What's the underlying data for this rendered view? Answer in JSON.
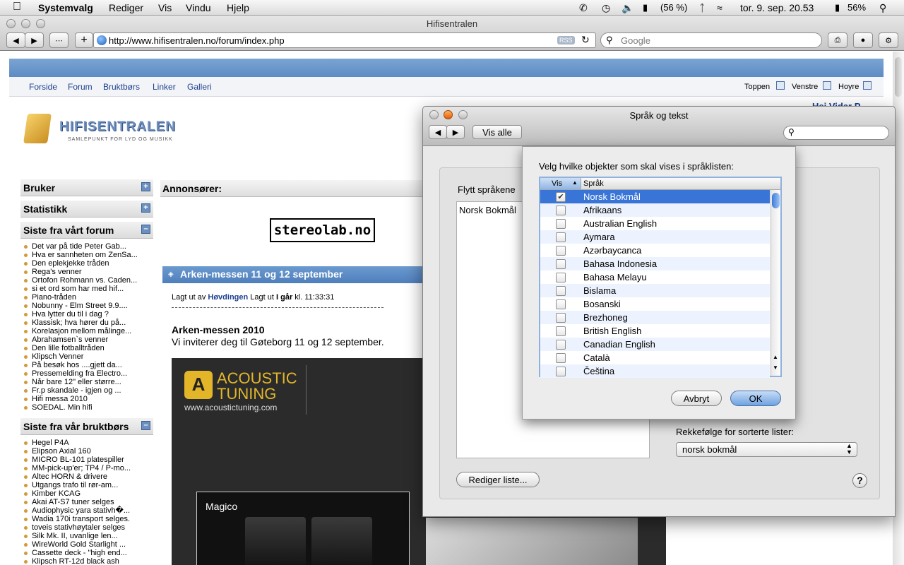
{
  "menubar": {
    "app": "Systemvalg",
    "items": [
      "Rediger",
      "Vis",
      "Vindu",
      "Hjelp"
    ],
    "battery_pct": "(56 %)",
    "clock": "tor. 9. sep. 20.53",
    "battery2": "56%"
  },
  "browser": {
    "title": "Hifisentralen",
    "url": "http://www.hifisentralen.no/forum/index.php",
    "rss": "RSS",
    "search_placeholder": "Google"
  },
  "site": {
    "nav": [
      "Forside",
      "Forum",
      "Bruktbørs",
      "Linker",
      "Galleri"
    ],
    "right_nav": [
      "Toppen",
      "Venstre",
      "Hoyre"
    ],
    "user_greeting": "Hei Vidar P",
    "logo_title": "HIFISENTRALEN",
    "logo_sub": "SAMLEPUNKT FOR LYD OG MUSIKK",
    "side_heads": [
      "Bruker",
      "Statistikk",
      "Siste fra vårt forum",
      "Siste fra vår bruktbørs"
    ],
    "forum_items": [
      "Det var på tide Peter Gab...",
      "Hva er sannheten om ZenSa...",
      "Den eplekjekke tråden",
      "Rega's venner",
      "Ortofon Rohmann vs. Caden...",
      "si et ord som har med hif...",
      "Piano-tråden",
      "Nobunny - Elm Street 9.9....",
      "Hva lytter du til i dag ?",
      "Klassisk; hva hører du på...",
      "Korelasjon mellom målinge...",
      "Abrahamsen`s venner",
      "Den lille fotballtråden",
      "Klipsch Venner",
      "På besøk hos ....gjett da...",
      "Pressemelding fra Electro...",
      "Når bare 12\" eller større...",
      "Fr.p skandale - igjen og ...",
      "Hifi messa 2010",
      "SOEDAL. Min hifi"
    ],
    "market_items": [
      "Hegel P4A",
      "Elipson Axial 160",
      "MICRO BL-101 platespiller",
      "MM-pick-up'er; TP4 / P-mo...",
      "Altec HORN & drivere",
      "Utgangs trafo til rør-am...",
      "Kimber KCAG",
      "Akai AT-S7 tuner selges",
      "Audiophysic yara stativh�...",
      "Wadia 170i transport selges.",
      "toveis stativhøytaler selges",
      "Silk Mk. II, uvanlige len...",
      "WireWorld Gold Starlight ...",
      "Cassette deck - \"high end...",
      "Klipsch RT-12d black ash"
    ],
    "ads_head": "Annonsører:",
    "ad_banner": "stereolab.no",
    "article_title": "Arken-messen 11 og 12 september",
    "posted_by_pre": "Lagt ut av",
    "posted_by": "Høvdingen",
    "posted_mid": "Lagt ut",
    "posted_when": "I går",
    "posted_time": "kl. 11:33:31",
    "article_heading": "Arken-messen 2010",
    "article_text": "Vi inviterer deg til Gøteborg 11 og 12 september.",
    "ad_brand1": "ACOUSTIC",
    "ad_brand2": "TUNING",
    "ad_url": "www.acoustictuning.com",
    "ad_magico": "Magico"
  },
  "dialog": {
    "title": "Språk og tekst",
    "show_all": "Vis alle",
    "move_label": "Flytt språkene",
    "current_lang": "Norsk Bokmål",
    "edit_list": "Rediger liste...",
    "sort_label": "Rekkefølge for sorterte lister:",
    "sort_value": "norsk bokmål",
    "help": "?"
  },
  "sheet": {
    "prompt": "Velg hvilke objekter som skal vises i språklisten:",
    "col_show": "Vis",
    "col_lang": "Språk",
    "languages": [
      {
        "name": "Norsk Bokmål",
        "checked": true
      },
      {
        "name": "Afrikaans",
        "checked": false
      },
      {
        "name": "Australian English",
        "checked": false
      },
      {
        "name": "Aymara",
        "checked": false
      },
      {
        "name": "Azərbaycanca",
        "checked": false
      },
      {
        "name": "Bahasa Indonesia",
        "checked": false
      },
      {
        "name": "Bahasa Melayu",
        "checked": false
      },
      {
        "name": "Bislama",
        "checked": false
      },
      {
        "name": "Bosanski",
        "checked": false
      },
      {
        "name": "Brezhoneg",
        "checked": false
      },
      {
        "name": "British English",
        "checked": false
      },
      {
        "name": "Canadian English",
        "checked": false
      },
      {
        "name": "Català",
        "checked": false
      },
      {
        "name": "Čeština",
        "checked": false
      }
    ],
    "cancel": "Avbryt",
    "ok": "OK"
  }
}
